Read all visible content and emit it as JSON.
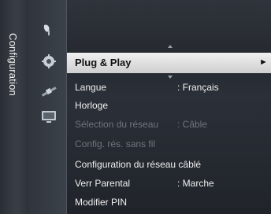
{
  "sidebar": {
    "title": "Configuration"
  },
  "icons": [
    "satellite-dish-icon",
    "gear-icon",
    "satellite-icon",
    "screen-icon"
  ],
  "highlighted": {
    "label": "Plug & Play",
    "arrow": "►"
  },
  "menu": [
    {
      "label": "Langue",
      "value": ": Français"
    },
    {
      "label": "Horloge",
      "value": ""
    },
    {
      "label": "Sélection du réseau",
      "value": ": Câble"
    },
    {
      "label": "Config. rés. sans fil",
      "value": ""
    },
    {
      "label": "Configuration du réseau câblé",
      "value": ""
    },
    {
      "label": "Verr Parental",
      "value": ": Marche"
    },
    {
      "label": "Modifier PIN",
      "value": ""
    }
  ]
}
